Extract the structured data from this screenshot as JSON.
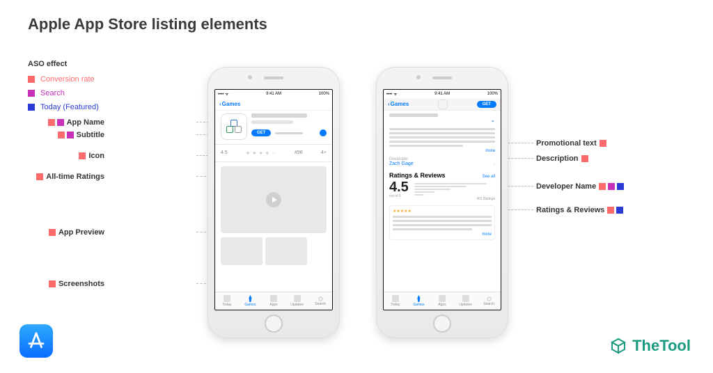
{
  "title": "Apple App Store listing elements",
  "legend": {
    "heading": "ASO effect",
    "items": [
      {
        "label": "Conversion rate",
        "color": "conv"
      },
      {
        "label": "Search",
        "color": "search"
      },
      {
        "label": "Today (Featured)",
        "color": "today"
      }
    ]
  },
  "left_annotations": {
    "app_name": "App Name",
    "subtitle": "Subtitle",
    "icon": "Icon",
    "all_time_ratings": "All-time Ratings",
    "app_preview": "App Preview",
    "screenshots": "Screenshots"
  },
  "right_annotations": {
    "promotional_text": "Promotional text",
    "description": "Description",
    "developer_name": "Developer Name",
    "ratings_reviews": "Ratings & Reviews"
  },
  "statusbar": {
    "time": "9:41 AM",
    "battery": "100%"
  },
  "nav": {
    "back": "Games",
    "get": "GET"
  },
  "tabs": [
    "Today",
    "Games",
    "Apps",
    "Updates",
    "Search"
  ],
  "phone1": {
    "rating_value": "4.5",
    "star_glyphs": "★ ★ ★ ★ ☆",
    "count": "#98",
    "age": "4+"
  },
  "phone2": {
    "more": "more",
    "developer_label": "Developer",
    "developer_name": "Zach Gage",
    "ratings_title": "Ratings & Reviews",
    "see_all": "See all",
    "score": "4.5",
    "out_of": "out of 5",
    "ratings_count": "401 Ratings"
  },
  "brand": "TheTool"
}
